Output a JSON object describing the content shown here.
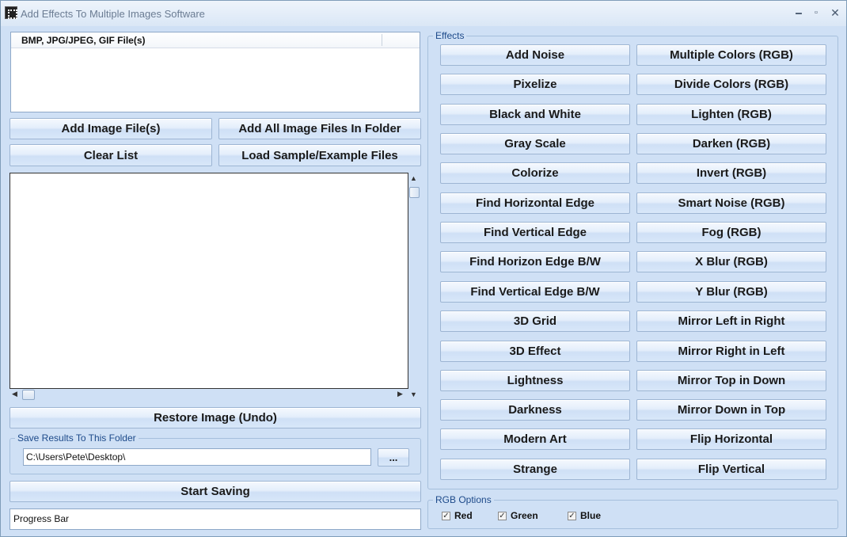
{
  "window": {
    "title": "Add Effects To Multiple Images Software",
    "minimize_glyph": "🗕",
    "maximize_glyph": "▫",
    "close_glyph": "✕"
  },
  "file_list": {
    "column_header": "BMP, JPG/JPEG, GIF File(s)"
  },
  "buttons": {
    "add_image_files": "Add Image File(s)",
    "add_all_in_folder": "Add All Image Files In Folder",
    "clear_list": "Clear List",
    "load_sample": "Load Sample/Example Files",
    "restore_image": "Restore Image (Undo)",
    "start_saving": "Start Saving",
    "browse": "..."
  },
  "save_folder": {
    "group_title": "Save Results To This Folder",
    "path": "C:\\Users\\Pete\\Desktop\\"
  },
  "progress": {
    "label": "Progress Bar"
  },
  "effects": {
    "group_title": "Effects",
    "left_column": [
      "Add Noise",
      "Pixelize",
      "Black and White",
      "Gray Scale",
      "Colorize",
      "Find Horizontal Edge",
      "Find Vertical Edge",
      "Find Horizon Edge B/W",
      "Find Vertical Edge B/W",
      "3D Grid",
      "3D Effect",
      "Lightness",
      "Darkness",
      "Modern Art",
      "Strange"
    ],
    "right_column": [
      "Multiple Colors (RGB)",
      "Divide Colors (RGB)",
      "Lighten (RGB)",
      "Darken (RGB)",
      "Invert (RGB)",
      "Smart Noise (RGB)",
      "Fog (RGB)",
      "X Blur (RGB)",
      "Y Blur (RGB)",
      "Mirror Left in Right",
      "Mirror Right in Left",
      "Mirror Top in Down",
      "Mirror Down in Top",
      "Flip Horizontal",
      "Flip Vertical"
    ]
  },
  "rgb_options": {
    "group_title": "RGB Options",
    "red": {
      "label": "Red",
      "checked": true
    },
    "green": {
      "label": "Green",
      "checked": true
    },
    "blue": {
      "label": "Blue",
      "checked": true
    },
    "check_glyph": "✓"
  }
}
